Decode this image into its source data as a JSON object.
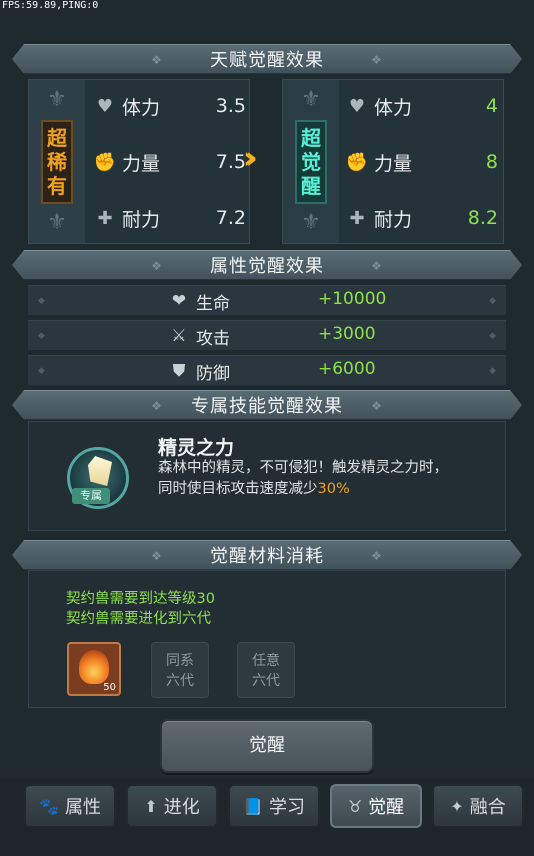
{
  "debug": {
    "fps_text": "FPS:59.89,PING:0"
  },
  "sections": {
    "talent_title": "天赋觉醒效果",
    "attr_title": "属性觉醒效果",
    "skill_title": "专属技能觉醒效果",
    "material_title": "觉醒材料消耗"
  },
  "talent": {
    "before": {
      "rarity": "超稀有",
      "stats": [
        {
          "label": "体力",
          "value": "3.5",
          "icon": "heart-icon"
        },
        {
          "label": "力量",
          "value": "7.5",
          "icon": "fist-icon"
        },
        {
          "label": "耐力",
          "value": "7.2",
          "icon": "endurance-icon"
        }
      ]
    },
    "after": {
      "rarity": "超觉醒",
      "stats": [
        {
          "label": "体力",
          "value": "4",
          "icon": "heart-icon"
        },
        {
          "label": "力量",
          "value": "8",
          "icon": "fist-icon"
        },
        {
          "label": "耐力",
          "value": "8.2",
          "icon": "endurance-icon"
        }
      ]
    }
  },
  "attributes": [
    {
      "label": "生命",
      "value": "+10000",
      "icon": "shield-heart-icon"
    },
    {
      "label": "攻击",
      "value": "+3000",
      "icon": "sword-icon"
    },
    {
      "label": "防御",
      "value": "+6000",
      "icon": "shield-icon"
    }
  ],
  "skill": {
    "icon_tag": "专属",
    "name": "精灵之力",
    "desc_line1": "森林中的精灵，不可侵犯！触发精灵之力时，",
    "desc_line2_prefix": "同时使目标攻击速度减少",
    "desc_highlight": "30%"
  },
  "materials": {
    "requirements": [
      "契约兽需要到达等级30",
      "契约兽需要进化到六代"
    ],
    "main_item_count": "50",
    "slots": [
      {
        "line1": "同系",
        "line2": "六代"
      },
      {
        "line1": "任意",
        "line2": "六代"
      }
    ]
  },
  "awaken_button": "觉醒",
  "tabs": [
    {
      "label": "属性",
      "icon": "paw-icon"
    },
    {
      "label": "进化",
      "icon": "arrow-up-icon"
    },
    {
      "label": "学习",
      "icon": "book-icon"
    },
    {
      "label": "觉醒",
      "icon": "horned-mask-icon"
    },
    {
      "label": "融合",
      "icon": "beast-icon"
    }
  ],
  "active_tab": "觉醒",
  "colors": {
    "green": "#8fe04a",
    "gold": "#f0a11e",
    "teal": "#56f0d8"
  }
}
